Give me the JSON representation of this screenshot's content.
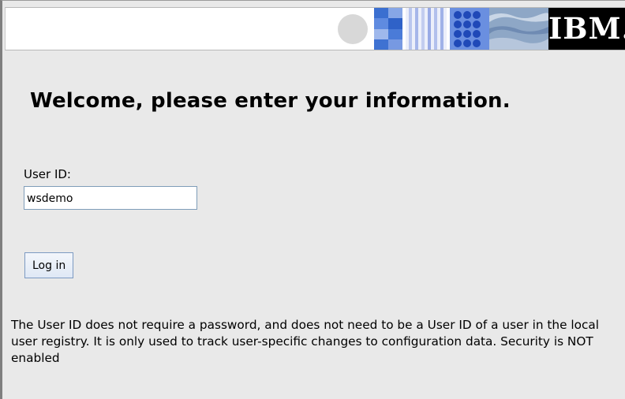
{
  "banner": {
    "logo_text": "IBM.",
    "colors": {
      "logo_background": "#000000",
      "tile_blue": "#4a7fd6",
      "tile_light_blue": "#9fb6e8",
      "tile_gray": "#d6d6d6"
    }
  },
  "page": {
    "heading": "Welcome, please enter your information."
  },
  "form": {
    "user_id_label": "User ID:",
    "user_id_value": "wsdemo",
    "login_label": "Log in"
  },
  "info": {
    "text": "The User ID does not require a password, and does not need to be a User ID of a user in the local user registry. It is only used to track user-specific changes to configuration data. Security is NOT enabled"
  }
}
